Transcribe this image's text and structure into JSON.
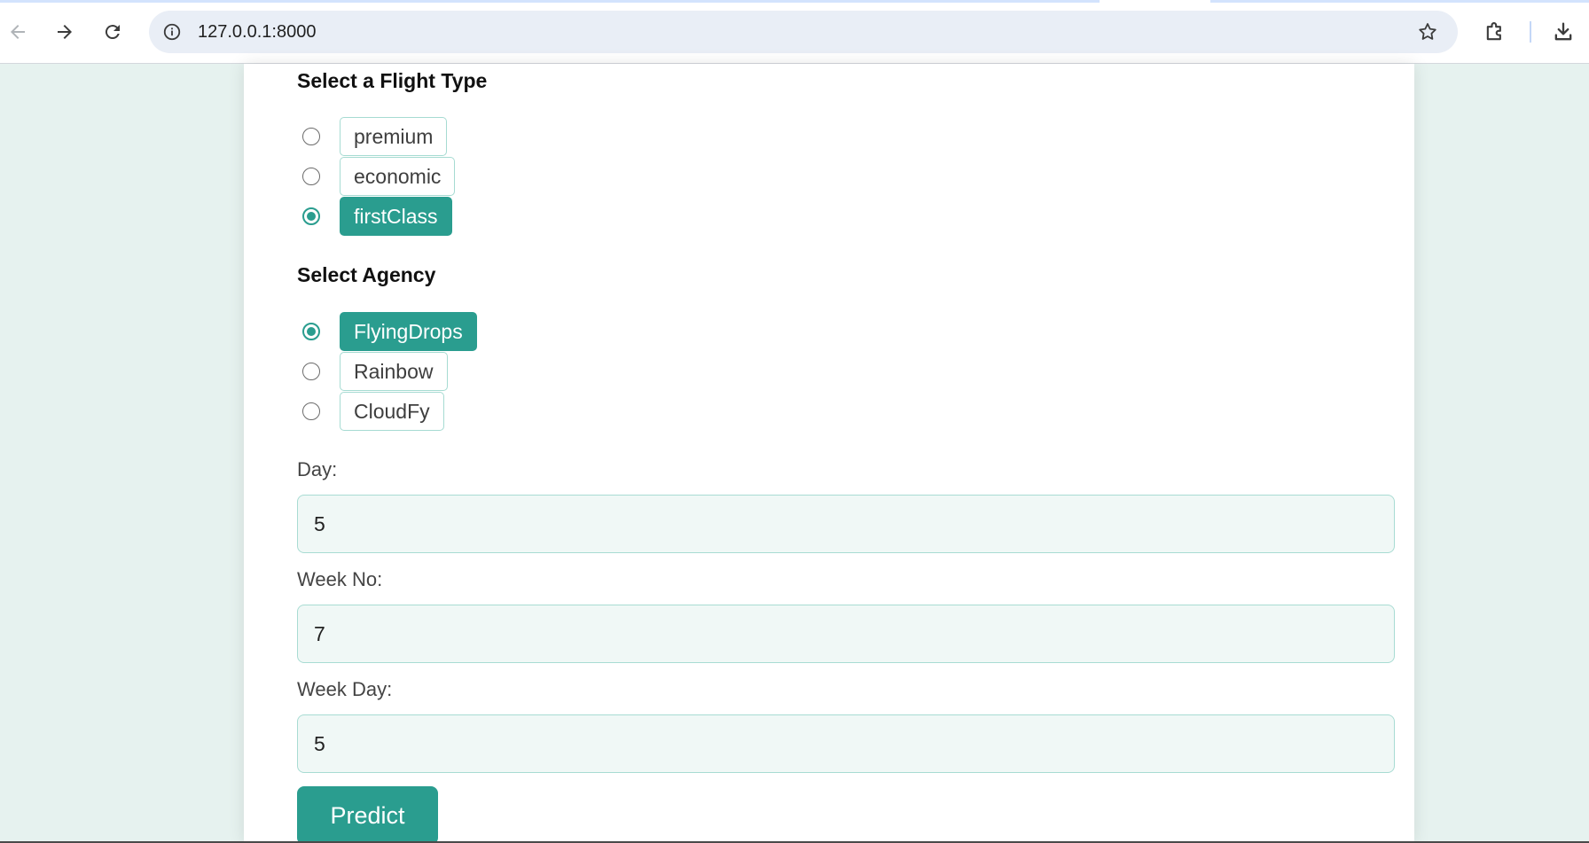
{
  "browser": {
    "url": "127.0.0.1:8000",
    "icons": [
      "back-icon",
      "forward-icon",
      "reload-icon",
      "info-icon",
      "star-icon",
      "extensions-icon",
      "download-icon"
    ]
  },
  "flight_type": {
    "title": "Select a Flight Type",
    "options": [
      {
        "label": "premium",
        "selected": false
      },
      {
        "label": "economic",
        "selected": false
      },
      {
        "label": "firstClass",
        "selected": true
      }
    ]
  },
  "agency": {
    "title": "Select Agency",
    "options": [
      {
        "label": "FlyingDrops",
        "selected": true
      },
      {
        "label": "Rainbow",
        "selected": false
      },
      {
        "label": "CloudFy",
        "selected": false
      }
    ]
  },
  "fields": {
    "day": {
      "label": "Day:",
      "value": "5"
    },
    "week_no": {
      "label": "Week No:",
      "value": "7"
    },
    "week_day": {
      "label": "Week Day:",
      "value": "5"
    }
  },
  "predict_label": "Predict",
  "colors": {
    "accent": "#2a9d8f",
    "background": "#e6f2ef",
    "input_bg": "#f0f8f6",
    "border": "#a8dcd3"
  }
}
